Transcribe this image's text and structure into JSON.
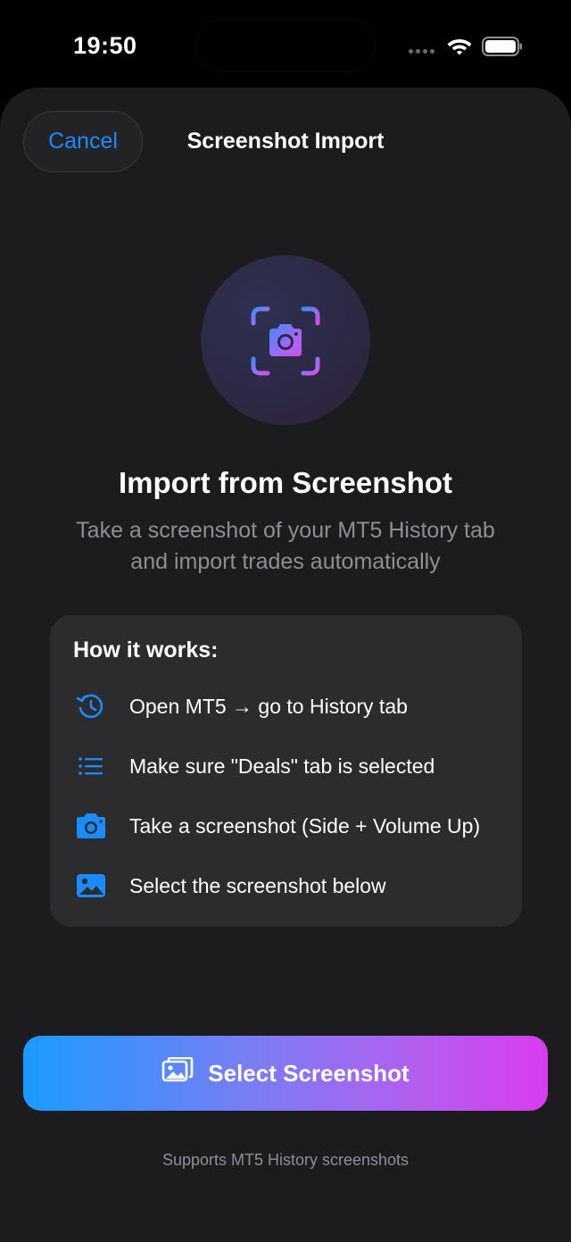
{
  "status_bar": {
    "time": "19:50",
    "wifi_icon": "wifi-icon",
    "battery_icon": "battery-icon"
  },
  "header": {
    "cancel_label": "Cancel",
    "title": "Screenshot Import"
  },
  "hero": {
    "icon": "camera-viewfinder-icon",
    "headline": "Import from Screenshot",
    "subtitle_line1": "Take a screenshot of your MT5 History tab",
    "subtitle_line2": "and import trades automatically"
  },
  "how_it_works": {
    "title": "How it works:",
    "steps": [
      {
        "icon": "history-clock-icon",
        "label": "Open MT5 → go to History tab"
      },
      {
        "icon": "list-icon",
        "label": "Make sure \"Deals\" tab is selected"
      },
      {
        "icon": "camera-icon",
        "label": "Take a screenshot (Side + Volume Up)"
      },
      {
        "icon": "photo-icon",
        "label": "Select the screenshot below"
      }
    ]
  },
  "primary_action": {
    "icon": "photo-stack-icon",
    "label": "Select Screenshot"
  },
  "footer": {
    "note": "Supports MT5 History screenshots"
  },
  "colors": {
    "accent": "#1a8cff",
    "background": "#1c1c1e",
    "card": "#2c2c2e",
    "gradient_start": "#1a9bff",
    "gradient_end": "#d83cef",
    "secondary_text": "#8e8e93"
  }
}
